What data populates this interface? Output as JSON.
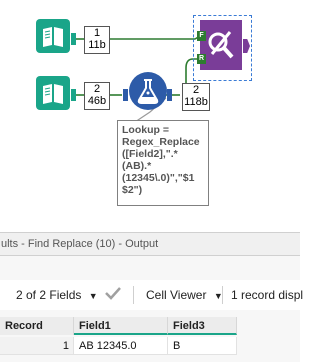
{
  "canvas": {
    "input_tool_top": {
      "count_line1": "1",
      "count_line2": "11b",
      "icon": "book-icon"
    },
    "input_tool_bottom": {
      "count_line1": "2",
      "count_line2": "46b",
      "icon": "book-icon"
    },
    "formula_tool": {
      "count_line1": "2",
      "count_line2": "118b",
      "icon": "flask-icon"
    },
    "find_replace_tool": {
      "anchor_f": "F",
      "anchor_r": "R",
      "icon": "find-replace-icon"
    },
    "annotation": "Lookup =\nRegex_Replace\n([Field2],\".*(AB).*\n(12345\\.0)\",\"$1\n$2\")",
    "colors": {
      "input": "#1aa589",
      "formula": "#2d5ba8",
      "find_replace": "#7a3d98",
      "wire": "#2d7c30"
    }
  },
  "results": {
    "title": "ults - Find Replace (10) - Output",
    "toolbar": {
      "fields_label": "2 of 2 Fields",
      "fields_dropdown_icon": "chevron-down-icon",
      "apply_icon": "checkmark-icon",
      "viewer_label": "Cell Viewer",
      "viewer_dropdown_icon": "chevron-down-icon",
      "record_info": "1 record displ"
    },
    "table": {
      "headers": [
        "Record",
        "Field1",
        "Field3"
      ],
      "rows": [
        {
          "record": "1",
          "field1": "AB 12345.0",
          "field3": "B"
        }
      ]
    }
  }
}
